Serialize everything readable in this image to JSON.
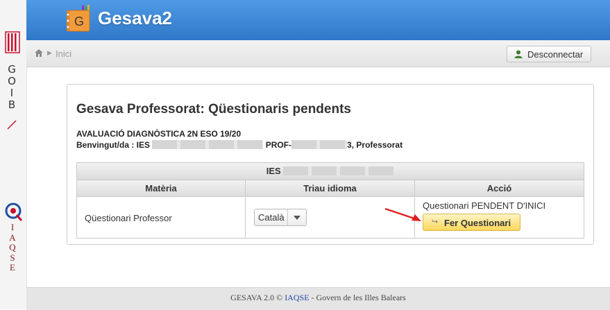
{
  "sidebar": {
    "goib_letters": [
      "G",
      "O",
      "I",
      "B"
    ],
    "iaqse_letters": [
      "I",
      "A",
      "Q",
      "S",
      "E"
    ]
  },
  "header": {
    "app_title": "Gesava2",
    "logo_letter": "G"
  },
  "breadcrumb": {
    "home_icon": "home-icon",
    "label": "Inici"
  },
  "logout": {
    "label": "Desconnectar",
    "icon": "user-icon"
  },
  "panel": {
    "title": "Gesava Professorat: Qüestionaris pendents",
    "subtitle": "AVALUACIÓ DIAGNÒSTICA 2N ESO 19/20",
    "welcome_prefix": "Benvingut/da : IES",
    "welcome_middle": "PROF-",
    "welcome_middle_tail": "3",
    "welcome_suffix": ", Professorat"
  },
  "table": {
    "school_prefix": "IES",
    "columns": [
      "Matèria",
      "Triau idioma",
      "Acció"
    ],
    "rows": [
      {
        "materia": "Qüestionari Professor",
        "idioma": "Català",
        "status": "Questionari PENDENT D'INICI",
        "action_label": "Fer Questionari"
      }
    ]
  },
  "footer": {
    "prefix": "GESAVA 2.0 ©",
    "link": "IAQSE",
    "suffix": "- Govern de les Illes Balears"
  },
  "colors": {
    "header_blue": "#3a86d8",
    "action_button": "#fbd85a",
    "annotation_arrow": "#e02020",
    "iaqse_red": "#8b1a22"
  }
}
